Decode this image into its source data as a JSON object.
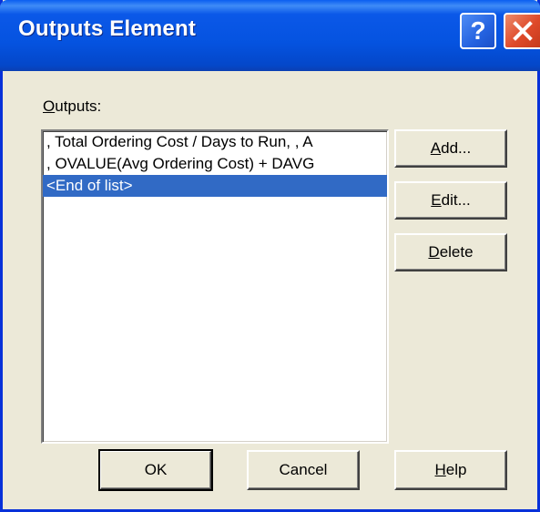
{
  "window": {
    "title": "Outputs Element"
  },
  "caption": {
    "help_glyph": "?",
    "help_icon": "question-mark-icon",
    "close_icon": "close-x-icon"
  },
  "outputs": {
    "label_mnemonic": "O",
    "label_rest": "utputs:",
    "items": [
      ", Total Ordering Cost / Days to Run, , A",
      ", OVALUE(Avg Ordering Cost) + DAVG",
      "<End of list>"
    ],
    "selected_index": 2
  },
  "side_buttons": {
    "add_mnemonic": "A",
    "add_rest": "dd...",
    "edit_mnemonic": "E",
    "edit_rest": "dit...",
    "delete_mnemonic": "D",
    "delete_rest": "elete"
  },
  "footer_buttons": {
    "ok": "OK",
    "cancel": "Cancel",
    "help_mnemonic": "H",
    "help_rest": "elp"
  },
  "colors": {
    "titlebar": "#0553e0",
    "selection": "#316ac5",
    "close": "#df4a2a",
    "face": "#ece9d8"
  }
}
